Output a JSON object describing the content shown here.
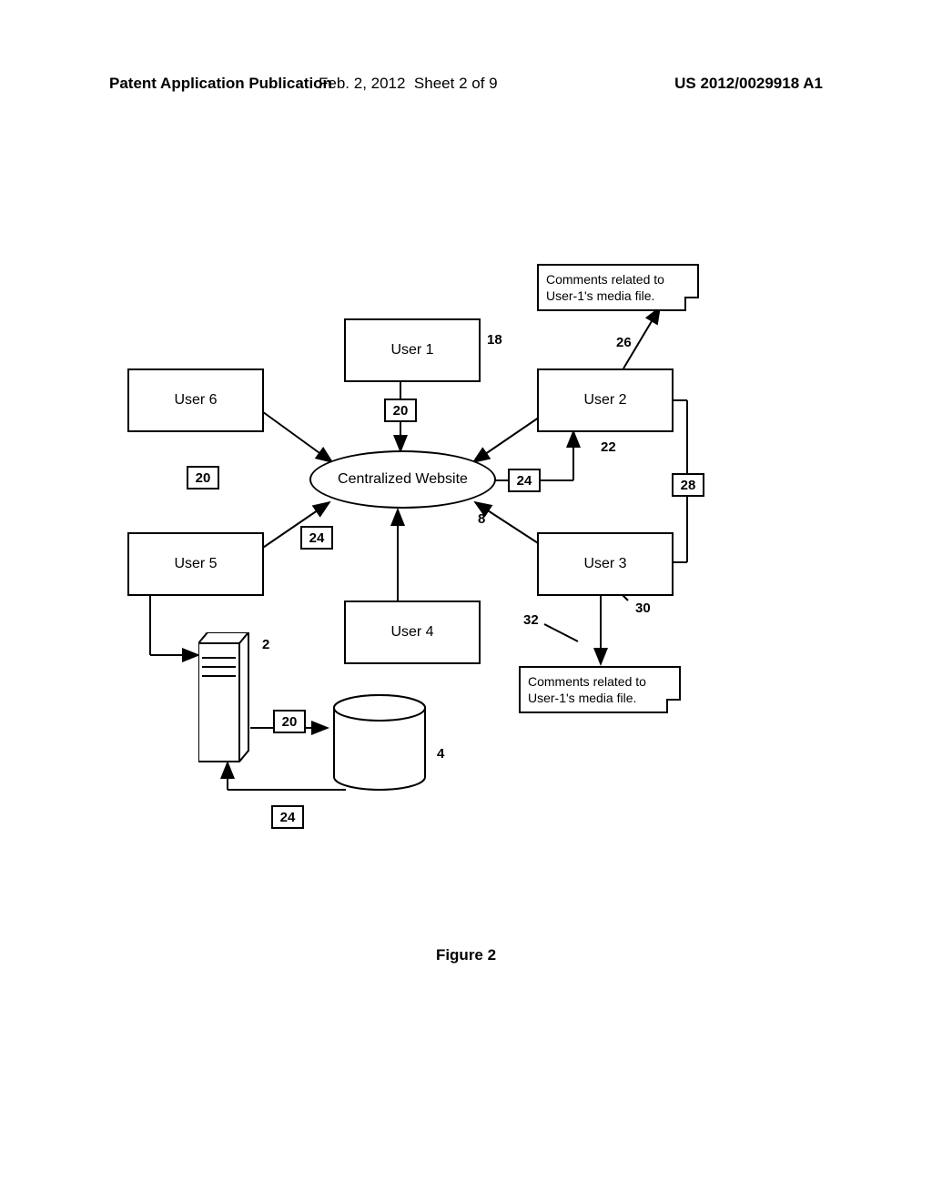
{
  "header": {
    "left": "Patent Application Publication",
    "center_date": "Feb. 2, 2012",
    "center_sheet": "Sheet 2 of 9",
    "right": "US 2012/0029918 A1"
  },
  "nodes": {
    "user1": "User 1",
    "user2": "User 2",
    "user3": "User 3",
    "user4": "User 4",
    "user5": "User 5",
    "user6": "User 6",
    "center": "Centralized Website",
    "comment_top": "Comments related to User-1's media file.",
    "comment_bottom": "Comments related to User-1's media file."
  },
  "refs": {
    "r2": "2",
    "r4": "4",
    "r8": "8",
    "r18": "18",
    "r20a": "20",
    "r20b": "20",
    "r20c": "20",
    "r22": "22",
    "r24a": "24",
    "r24b": "24",
    "r24c": "24",
    "r26": "26",
    "r28": "28",
    "r30": "30",
    "r32": "32"
  },
  "caption": "Figure 2"
}
